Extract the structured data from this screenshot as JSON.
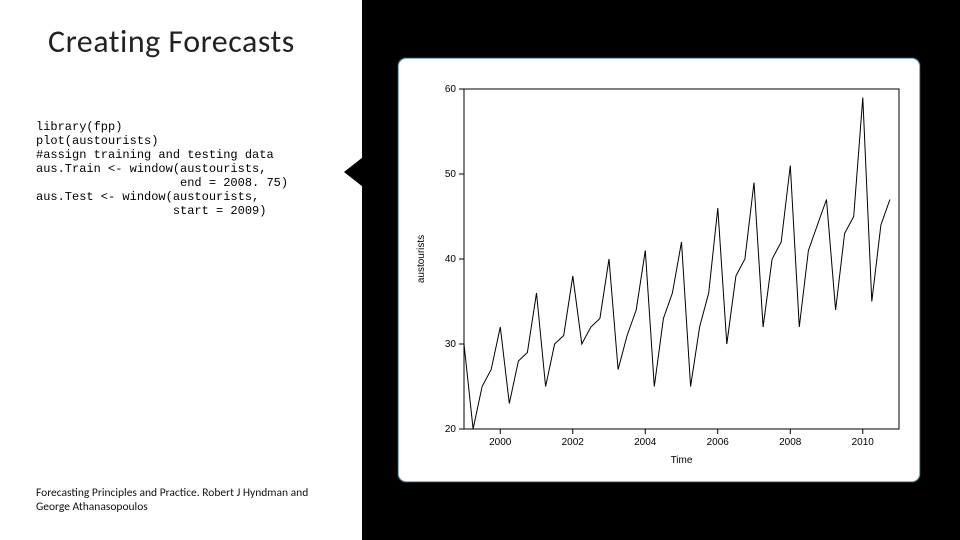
{
  "title": "Creating Forecasts",
  "code": "library(fpp)\nplot(austourists)\n#assign training and testing data\naus.Train <- window(austourists,\n                    end = 2008. 75)\naus.Test <- window(austourists,\n                   start = 2009)",
  "citation": "Forecasting Principles and Practice. Robert J Hyndman and George Athanasopoulos",
  "chart_data": {
    "type": "line",
    "title": "",
    "xlabel": "Time",
    "ylabel": "austourists",
    "xlim": [
      1999,
      2011
    ],
    "ylim": [
      20,
      60
    ],
    "xticks": [
      2000,
      2002,
      2004,
      2006,
      2008,
      2010
    ],
    "yticks": [
      20,
      30,
      40,
      50,
      60
    ],
    "x": [
      1999.0,
      1999.25,
      1999.5,
      1999.75,
      2000.0,
      2000.25,
      2000.5,
      2000.75,
      2001.0,
      2001.25,
      2001.5,
      2001.75,
      2002.0,
      2002.25,
      2002.5,
      2002.75,
      2003.0,
      2003.25,
      2003.5,
      2003.75,
      2004.0,
      2004.25,
      2004.5,
      2004.75,
      2005.0,
      2005.25,
      2005.5,
      2005.75,
      2006.0,
      2006.25,
      2006.5,
      2006.75,
      2007.0,
      2007.25,
      2007.5,
      2007.75,
      2008.0,
      2008.25,
      2008.5,
      2008.75,
      2009.0,
      2009.25,
      2009.5,
      2009.75,
      2010.0,
      2010.25,
      2010.5,
      2010.75
    ],
    "values": [
      30,
      20,
      25,
      27,
      32,
      23,
      28,
      29,
      36,
      25,
      30,
      31,
      38,
      30,
      32,
      33,
      40,
      27,
      31,
      34,
      41,
      25,
      33,
      36,
      42,
      25,
      32,
      36,
      46,
      30,
      38,
      40,
      49,
      32,
      40,
      42,
      51,
      32,
      41,
      44,
      47,
      34,
      43,
      45,
      59,
      35,
      44,
      47
    ]
  }
}
